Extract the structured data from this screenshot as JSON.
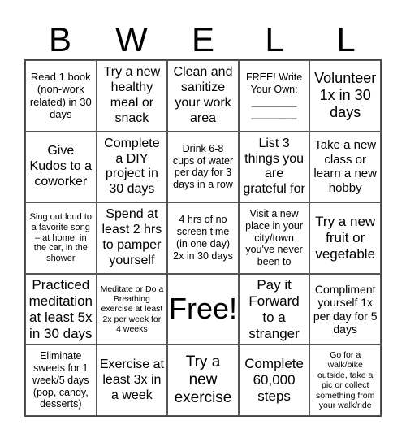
{
  "title_letters": [
    "B",
    "W",
    "E",
    "L",
    "L"
  ],
  "cells": [
    [
      "Read 1 book (non-work related) in 30 days",
      "Try a new healthy meal or snack",
      "Clean and sanitize your work area",
      "FREE! Write Your Own: ________ ________",
      "Volunteer 1x in 30 days"
    ],
    [
      "Give Kudos to a coworker",
      "Complete a DIY project in 30 days",
      "Drink 6-8 cups of water per day for 3 days in a row",
      "List 3 things you are grateful for",
      "Take a new class or learn a new hobby"
    ],
    [
      "Sing out loud to a favorite song – at home, in the car, in the shower",
      "Spend at least 2 hrs to pamper yourself",
      "4 hrs of no screen time (in one day) 2x in 30 days",
      "Visit a new place in your city/town you've never been to",
      "Try a new fruit or vegetable"
    ],
    [
      "Practiced meditation at least 5x in 30 days",
      "Meditate or Do a Breathing exercise at least 2x per week for 4 weeks",
      "Free!",
      "Pay it Forward to a stranger",
      "Compliment yourself 1x per day for 5 days"
    ],
    [
      "Eliminate sweets for 1 week/5 days (pop, candy, desserts)",
      "Exercise at least 3x in a week",
      "Try a new exercise",
      "Complete 60,000 steps",
      "Go for a walk/bike outside, take a pic or collect something from your walk/ride"
    ]
  ]
}
